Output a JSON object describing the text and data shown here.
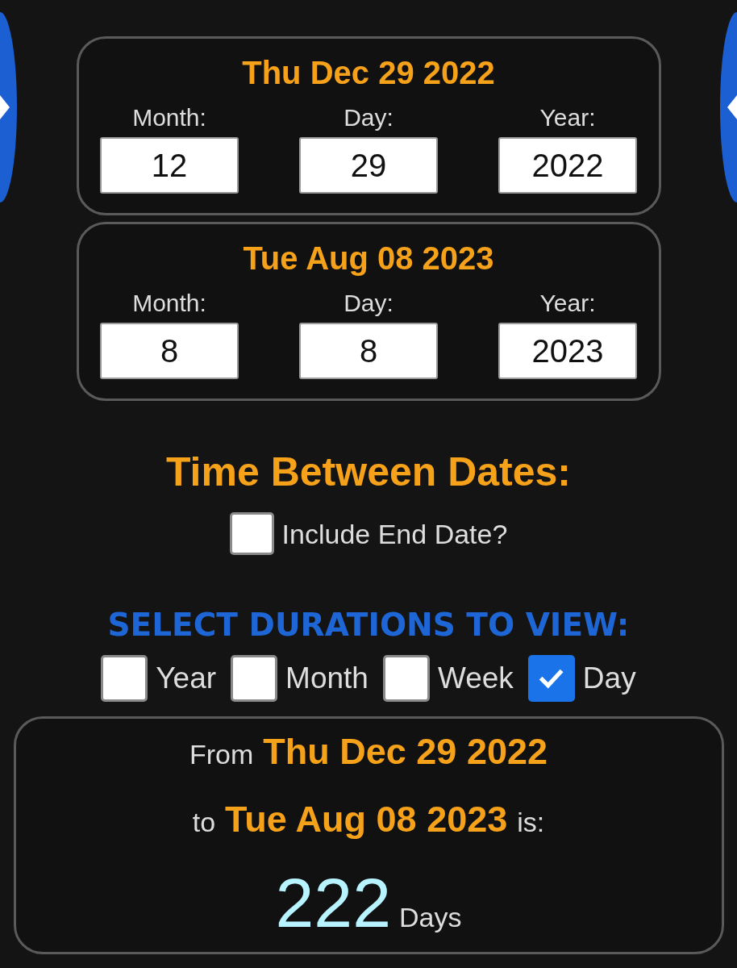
{
  "date_cards": [
    {
      "title": "Thu Dec 29 2022",
      "fields": [
        {
          "label": "Month:",
          "value": "12"
        },
        {
          "label": "Day:",
          "value": "29"
        },
        {
          "label": "Year:",
          "value": "2022"
        }
      ]
    },
    {
      "title": "Tue Aug 08 2023",
      "fields": [
        {
          "label": "Month:",
          "value": "8"
        },
        {
          "label": "Day:",
          "value": "8"
        },
        {
          "label": "Year:",
          "value": "2023"
        }
      ]
    }
  ],
  "heading": "Time Between Dates:",
  "include_end_date": {
    "label": "Include End Date?",
    "checked": false
  },
  "durations": {
    "heading": "SELECT DURATIONS TO VIEW:",
    "options": [
      {
        "label": "Year",
        "checked": false
      },
      {
        "label": "Month",
        "checked": false
      },
      {
        "label": "Week",
        "checked": false
      },
      {
        "label": "Day",
        "checked": true
      }
    ]
  },
  "result": {
    "from_label": "From",
    "from_date": "Thu Dec 29 2022",
    "to_label": "to",
    "to_date": "Tue Aug 08 2023",
    "is_label": "is:",
    "count": "222",
    "unit": "Days"
  }
}
